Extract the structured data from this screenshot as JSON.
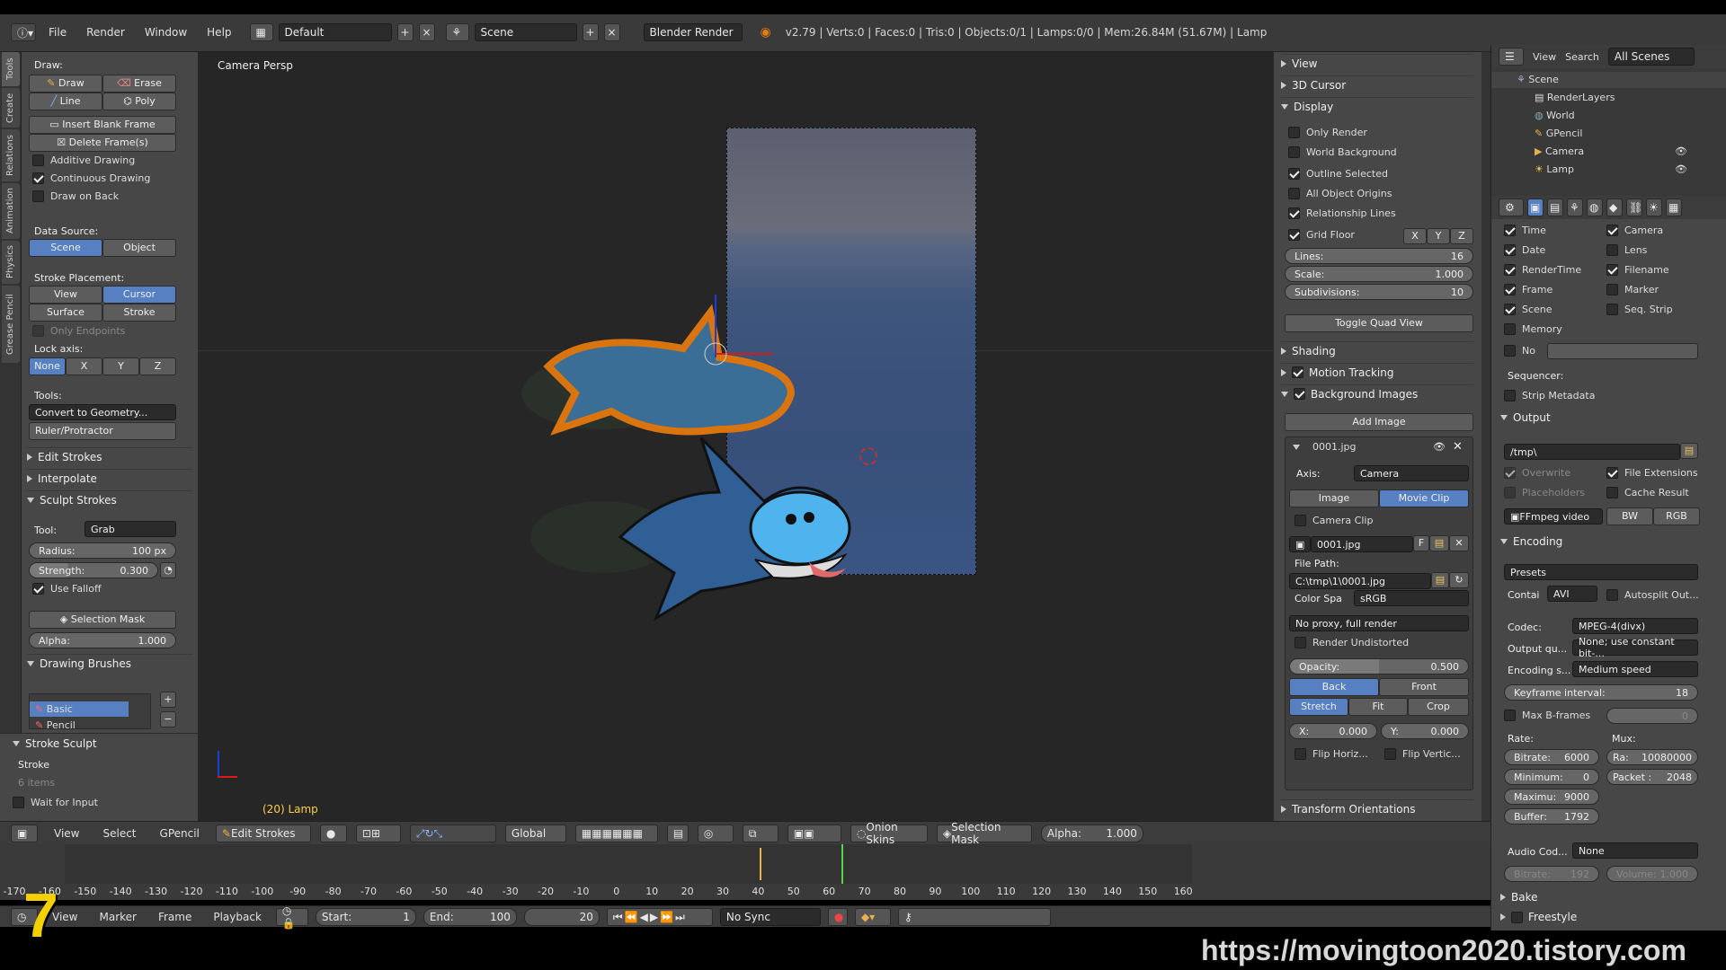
{
  "topbar": {
    "menus": [
      "File",
      "Render",
      "Window",
      "Help"
    ],
    "layout": "Default",
    "scene": "Scene",
    "engine": "Blender Render",
    "stats": "v2.79 | Verts:0 | Faces:0 | Tris:0 | Objects:0/1 | Lamps:0/0 | Mem:26.84M (51.67M) | Lamp"
  },
  "tabs": [
    "Tools",
    "Create",
    "Relations",
    "Animation",
    "Physics",
    "Grease Pencil"
  ],
  "tool": {
    "draw_label": "Draw:",
    "draw": "Draw",
    "erase": "Erase",
    "line": "Line",
    "poly": "Poly",
    "insert_blank": "Insert Blank Frame",
    "delete_frames": "Delete Frame(s)",
    "additive": "Additive Drawing",
    "continuous": "Continuous Drawing",
    "draw_on_back": "Draw on Back",
    "data_source": "Data Source:",
    "scene": "Scene",
    "object": "Object",
    "stroke_placement": "Stroke Placement:",
    "view": "View",
    "cursor": "Cursor",
    "surface": "Surface",
    "stroke": "Stroke",
    "only_endpoints": "Only Endpoints",
    "lock_axis": "Lock axis:",
    "none": "None",
    "x": "X",
    "y": "Y",
    "z": "Z",
    "tools_label": "Tools:",
    "convert": "Convert to Geometry...",
    "ruler": "Ruler/Protractor",
    "edit_strokes": "Edit Strokes",
    "interpolate": "Interpolate",
    "sculpt_strokes": "Sculpt Strokes",
    "tool_label": "Tool:",
    "tool_value": "Grab",
    "radius_label": "Radius:",
    "radius_value": "100 px",
    "strength_label": "Strength:",
    "strength_value": "0.300",
    "use_falloff": "Use Falloff",
    "selection_mask": "Selection Mask",
    "alpha_label": "Alpha:",
    "alpha_value": "1.000",
    "drawing_brushes": "Drawing Brushes",
    "brush_basic": "Basic",
    "brush_pencil": "Pencil",
    "stroke_sculpt": "Stroke Sculpt",
    "stroke_label": "Stroke",
    "items": "6 items",
    "wait_for_input": "Wait for Input"
  },
  "viewport": {
    "label": "Camera Persp",
    "object_info": "(20) Lamp"
  },
  "npanel": {
    "view": "View",
    "cursor3d": "3D Cursor",
    "display": "Display",
    "only_render": "Only Render",
    "world_bg": "World Background",
    "outline_selected": "Outline Selected",
    "all_origins": "All Object Origins",
    "relationship_lines": "Relationship Lines",
    "grid_floor": "Grid Floor",
    "x": "X",
    "y": "Y",
    "z": "Z",
    "lines_label": "Lines:",
    "lines_value": "16",
    "scale_label": "Scale:",
    "scale_value": "1.000",
    "subdiv_label": "Subdivisions:",
    "subdiv_value": "10",
    "toggle_quad": "Toggle Quad View",
    "shading": "Shading",
    "motion_tracking": "Motion Tracking",
    "bg_images": "Background Images",
    "add_image": "Add Image",
    "image_name": "0001.jpg",
    "axis_label": "Axis:",
    "axis_value": "Camera",
    "image": "Image",
    "movie_clip": "Movie Clip",
    "camera_clip": "Camera Clip",
    "img_field": "0001.jpg",
    "f": "F",
    "file_path_label": "File Path:",
    "file_path": "C:\\tmp\\1\\0001.jpg",
    "color_space_label": "Color Spa",
    "color_space": "sRGB",
    "proxy": "No proxy, full render",
    "render_undistorted": "Render Undistorted",
    "opacity_label": "Opacity:",
    "opacity_value": "0.500",
    "back": "Back",
    "front": "Front",
    "stretch": "Stretch",
    "fit": "Fit",
    "crop": "Crop",
    "x_label": "X:",
    "x_value": "0.000",
    "y_label": "Y:",
    "y_value": "0.000",
    "flip_h": "Flip Horiz...",
    "flip_v": "Flip Vertic...",
    "transform_orient": "Transform Orientations"
  },
  "outliner": {
    "view": "View",
    "search": "Search",
    "filter": "All Scenes",
    "items": [
      "Scene",
      "RenderLayers",
      "World",
      "GPencil",
      "Camera",
      "Lamp"
    ]
  },
  "props": {
    "time": "Time",
    "camera": "Camera",
    "date": "Date",
    "lens": "Lens",
    "rendertime": "RenderTime",
    "filename": "Filename",
    "frame": "Frame",
    "marker": "Marker",
    "scene": "Scene",
    "seq_strip": "Seq. Strip",
    "memory": "Memory",
    "no": "No",
    "sequencer": "Sequencer:",
    "strip_metadata": "Strip Metadata",
    "output": "Output",
    "output_path": "/tmp\\",
    "overwrite": "Overwrite",
    "file_ext": "File Extensions",
    "placeholders": "Placeholders",
    "cache_result": "Cache Result",
    "format": "FFmpeg video",
    "bw": "BW",
    "rgb": "RGB",
    "encoding": "Encoding",
    "presets": "Presets",
    "container_label": "Contai",
    "container": "AVI",
    "autosplit": "Autosplit Out...",
    "codec_label": "Codec:",
    "codec": "MPEG-4(divx)",
    "output_q_label": "Output qu...",
    "output_q": "None; use constant bit-...",
    "enc_speed_label": "Encoding s...",
    "enc_speed": "Medium speed",
    "keyframe_label": "Keyframe interval:",
    "keyframe_value": "18",
    "max_bframes": "Max B-frames",
    "bframes_value": "0",
    "rate": "Rate:",
    "mux": "Mux:",
    "bitrate_label": "Bitrate:",
    "bitrate_value": "6000",
    "ra_label": "Ra:",
    "ra_value": "10080000",
    "minimum_label": "Minimum:",
    "minimum_value": "0",
    "packet_label": "Packet :",
    "packet_value": "2048",
    "maximum_label": "Maximu:",
    "maximum_value": "9000",
    "buffer_label": "Buffer:",
    "buffer_value": "1792",
    "audio_codec_label": "Audio Cod...",
    "audio_codec": "None",
    "a_bitrate_label": "Bitrate:",
    "a_bitrate_value": "192",
    "volume_label": "Volume:",
    "volume_value": "1.000",
    "bake": "Bake",
    "freestyle": "Freestyle"
  },
  "vphdr": {
    "menus": [
      "View",
      "Select",
      "GPencil"
    ],
    "mode": "Edit Strokes",
    "orientation": "Global",
    "onion_skins": "Onion Skins",
    "selection_mask": "Selection Mask",
    "alpha_label": "Alpha:",
    "alpha_value": "1.000"
  },
  "timeline": {
    "ticks": [
      "-170",
      "-160",
      "-150",
      "-140",
      "-130",
      "-120",
      "-110",
      "-100",
      "-90",
      "-80",
      "-70",
      "-60",
      "-50",
      "-40",
      "-30",
      "-20",
      "-10",
      "0",
      "10",
      "20",
      "30",
      "40",
      "50",
      "60",
      "70",
      "80",
      "90",
      "100",
      "110",
      "120",
      "130",
      "140",
      "150",
      "160"
    ],
    "current_frame": 20
  },
  "tlhdr": {
    "menus": [
      "View",
      "Marker",
      "Frame",
      "Playback"
    ],
    "start_label": "Start:",
    "start_value": "1",
    "end_label": "End:",
    "end_value": "100",
    "frame_value": "20",
    "sync": "No Sync"
  },
  "footer": {
    "number": "7",
    "url": "https://movingtoon2020.tistory.com"
  },
  "colors": {
    "accent": "#5680c2",
    "panel": "#474747",
    "viewport": "#262626"
  }
}
